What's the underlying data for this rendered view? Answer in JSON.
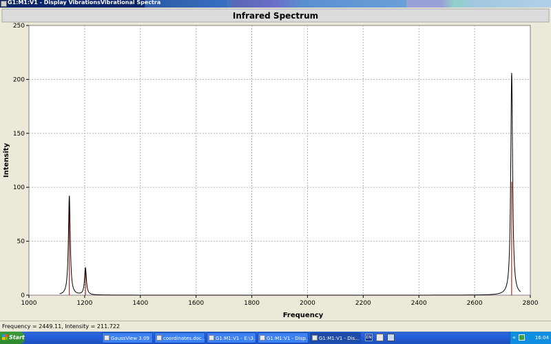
{
  "window": {
    "title": "G1:M1:V1 - Display VibrationsVibrational Spectra"
  },
  "chart_data": {
    "type": "line",
    "title": "Infrared Spectrum",
    "xlabel": "Frequency",
    "ylabel": "Intensity",
    "xlim": [
      1000,
      2800
    ],
    "ylim": [
      0,
      250
    ],
    "x_ticks": [
      1000,
      1200,
      1400,
      1600,
      1800,
      2000,
      2200,
      2400,
      2600,
      2800
    ],
    "x_tick_labels": [
      "1000",
      "1200",
      "1400",
      "1600",
      "1800",
      "2000",
      "2200",
      "2400",
      "2600",
      "2800"
    ],
    "y_ticks": [
      0,
      50,
      100,
      150,
      200,
      250
    ],
    "y_tick_labels": [
      "0",
      "50",
      "100",
      "150",
      "200",
      "250"
    ],
    "grid": true,
    "peaks": [
      {
        "frequency": 1145,
        "intensity": 92
      },
      {
        "frequency": 1203,
        "intensity": 25
      },
      {
        "frequency": 2733,
        "intensity": 206
      }
    ],
    "stick_lines": [
      {
        "frequency": 1145,
        "intensity": 92
      },
      {
        "frequency": 1203,
        "intensity": 23
      },
      {
        "frequency": 2733,
        "intensity": 105
      }
    ],
    "colors": {
      "curve": "#000000",
      "sticks": "#a00000",
      "grid": "#b0b0b0",
      "plot_bg": "#ffffff",
      "title_bar": "#dcdcdc"
    }
  },
  "status": {
    "text": "Frequency = 2449.11,  Intensity = 211.722"
  },
  "taskbar": {
    "start": "Start",
    "tasks": [
      {
        "label": "GaussView 3.09",
        "active": false
      },
      {
        "label": "coordinates.doc...",
        "active": false
      },
      {
        "label": "G1:M1:V1 - E:\\3...",
        "active": false
      },
      {
        "label": "G1:M1:V1 - Disp...",
        "active": false
      },
      {
        "label": "G1:M1:V1 - Dis...",
        "active": true
      }
    ],
    "lang": "EN",
    "tray_arrows": "«",
    "clock": "16:04"
  }
}
